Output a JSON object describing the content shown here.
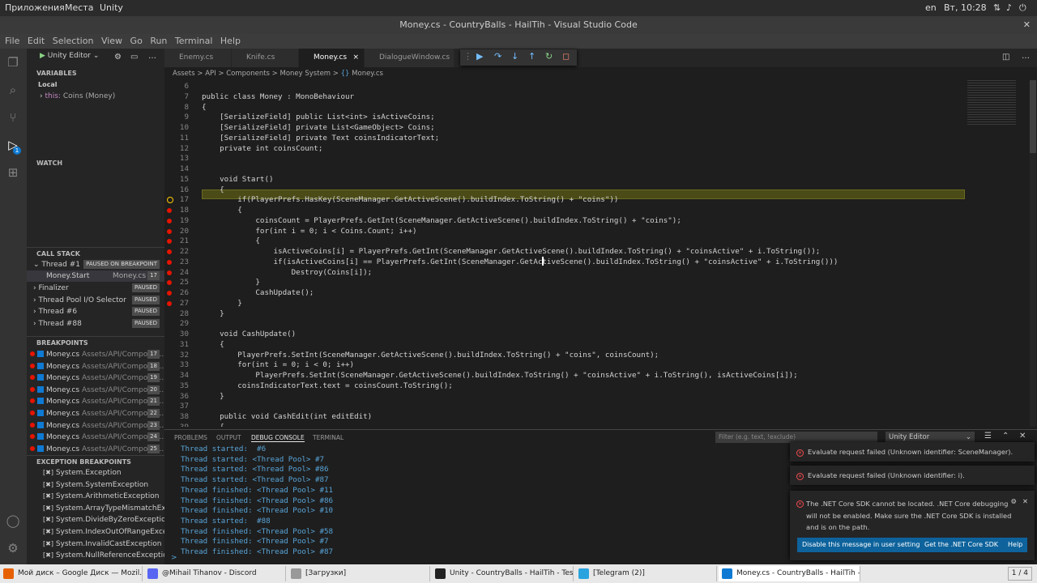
{
  "gnome": {
    "apps": "Приложения",
    "places": "Места",
    "app": "Unity",
    "lang": "en",
    "clock": "Вт, 10:28"
  },
  "window_title": "Money.cs - CountryBalls - HailTih - Visual Studio Code",
  "menu": [
    "File",
    "Edit",
    "Selection",
    "View",
    "Go",
    "Run",
    "Terminal",
    "Help"
  ],
  "run_config": "Unity Editor",
  "activity_badge": "1",
  "variables": {
    "header": "VARIABLES",
    "local": "Local",
    "this_label": "this:",
    "this_value": "Coins (Money)"
  },
  "watch_header": "WATCH",
  "callstack": {
    "header": "CALL STACK",
    "thread1": "Thread #1",
    "thread1_status": "PAUSED ON BREAKPOINT",
    "frame": "Money.Start",
    "frame_file": "Money.cs",
    "frame_line": "17",
    "others": [
      {
        "name": "Finalizer",
        "status": "PAUSED"
      },
      {
        "name": "Thread Pool I/O Selector",
        "status": "PAUSED"
      },
      {
        "name": "Thread #6",
        "status": "PAUSED"
      },
      {
        "name": "Thread #88",
        "status": "PAUSED"
      }
    ]
  },
  "breakpoints": {
    "header": "BREAKPOINTS",
    "items": [
      {
        "file": "Money.cs",
        "path": "Assets/API/Compone...",
        "line": "17"
      },
      {
        "file": "Money.cs",
        "path": "Assets/API/Compone...",
        "line": "18"
      },
      {
        "file": "Money.cs",
        "path": "Assets/API/Compone...",
        "line": "19"
      },
      {
        "file": "Money.cs",
        "path": "Assets/API/Compone...",
        "line": "20"
      },
      {
        "file": "Money.cs",
        "path": "Assets/API/Compone...",
        "line": "21"
      },
      {
        "file": "Money.cs",
        "path": "Assets/API/Compone...",
        "line": "22"
      },
      {
        "file": "Money.cs",
        "path": "Assets/API/Compone...",
        "line": "23"
      },
      {
        "file": "Money.cs",
        "path": "Assets/API/Compone...",
        "line": "24"
      },
      {
        "file": "Money.cs",
        "path": "Assets/API/Compone...",
        "line": "25"
      }
    ]
  },
  "exceptions": {
    "header": "EXCEPTION BREAKPOINTS",
    "items": [
      "System.Exception",
      "System.SystemException",
      "System.ArithmeticException",
      "System.ArrayTypeMismatchEx...",
      "System.DivideByZeroException",
      "System.IndexOutOfRangeExce...",
      "System.InvalidCastException",
      "System.NullReferenceException"
    ]
  },
  "tabs": [
    "Enemy.cs",
    "Knife.cs",
    "Money.cs",
    "DialogueWindow.cs"
  ],
  "breadcrumb": [
    "Assets",
    ">",
    "API",
    ">",
    "Components",
    ">",
    "Money System",
    ">",
    "Money.cs"
  ],
  "code_lines": [
    {
      "n": "6",
      "t": ""
    },
    {
      "n": "7",
      "t": "public class Money : MonoBehaviour"
    },
    {
      "n": "8",
      "t": "{"
    },
    {
      "n": "9",
      "t": "    [SerializeField] public List<int> isActiveCoins;"
    },
    {
      "n": "10",
      "t": "    [SerializeField] private List<GameObject> Coins;"
    },
    {
      "n": "11",
      "t": "    [SerializeField] private Text coinsIndicatorText;"
    },
    {
      "n": "12",
      "t": "    private int coinsCount;"
    },
    {
      "n": "13",
      "t": ""
    },
    {
      "n": "14",
      "t": ""
    },
    {
      "n": "15",
      "t": "    void Start()"
    },
    {
      "n": "16",
      "t": "    {"
    },
    {
      "n": "17",
      "t": "        if(PlayerPrefs.HasKey(SceneManager.GetActiveScene().buildIndex.ToString() + \"coins\"))"
    },
    {
      "n": "18",
      "t": "        {"
    },
    {
      "n": "19",
      "t": "            coinsCount = PlayerPrefs.GetInt(SceneManager.GetActiveScene().buildIndex.ToString() + \"coins\");"
    },
    {
      "n": "20",
      "t": "            for(int i = 0; i < Coins.Count; i++)"
    },
    {
      "n": "21",
      "t": "            {"
    },
    {
      "n": "22",
      "t": "                isActiveCoins[i] = PlayerPrefs.GetInt(SceneManager.GetActiveScene().buildIndex.ToString() + \"coinsActive\" + i.ToString());"
    },
    {
      "n": "23",
      "t": "                if(isActiveCoins[i] == PlayerPrefs.GetInt(SceneManager.GetActiveScene().buildIndex.ToString() + \"coinsActive\" + i.ToString()))"
    },
    {
      "n": "24",
      "t": "                    Destroy(Coins[i]);"
    },
    {
      "n": "25",
      "t": "            }"
    },
    {
      "n": "26",
      "t": "            CashUpdate();"
    },
    {
      "n": "27",
      "t": "        }"
    },
    {
      "n": "28",
      "t": "    }"
    },
    {
      "n": "29",
      "t": ""
    },
    {
      "n": "30",
      "t": "    void CashUpdate()"
    },
    {
      "n": "31",
      "t": "    {"
    },
    {
      "n": "32",
      "t": "        PlayerPrefs.SetInt(SceneManager.GetActiveScene().buildIndex.ToString() + \"coins\", coinsCount);"
    },
    {
      "n": "33",
      "t": "        for(int i = 0; i < 0; i++)"
    },
    {
      "n": "34",
      "t": "            PlayerPrefs.SetInt(SceneManager.GetActiveScene().buildIndex.ToString() + \"coinsActive\" + i.ToString(), isActiveCoins[i]);"
    },
    {
      "n": "35",
      "t": "        coinsIndicatorText.text = coinsCount.ToString();"
    },
    {
      "n": "36",
      "t": "    }"
    },
    {
      "n": "37",
      "t": ""
    },
    {
      "n": "38",
      "t": "    public void CashEdit(int editEdit)"
    },
    {
      "n": "39",
      "t": "    {"
    }
  ],
  "panel": {
    "tabs": [
      "PROBLEMS",
      "OUTPUT",
      "DEBUG CONSOLE",
      "TERMINAL"
    ],
    "filter_placeholder": "Filter (e.g. text, !exclude)",
    "dropdown": "Unity Editor",
    "lines": [
      "Thread started:  #6",
      "Thread started: <Thread Pool> #7",
      "Thread started: <Thread Pool> #86",
      "Thread started: <Thread Pool> #87",
      "Thread finished: <Thread Pool> #11",
      "Thread finished: <Thread Pool> #86",
      "Thread finished: <Thread Pool> #10",
      "Thread started:  #88",
      "Thread finished: <Thread Pool> #58",
      "Thread finished: <Thread Pool> #7",
      "Thread finished: <Thread Pool> #87"
    ],
    "prompt": ">"
  },
  "notifications": {
    "n1": "Evaluate request failed (Unknown identifier: SceneManager).",
    "n2": "Evaluate request failed (Unknown identifier: i).",
    "n3_l1": "The .NET Core SDK cannot be located. .NET Core debugging",
    "n3_l2": "will not be enabled. Make sure the .NET Core SDK is installed",
    "n3_l3": "and is on the path.",
    "btn_disable": "Disable this message in user settings",
    "btn_get": "Get the .NET Core SDK",
    "btn_help": "Help"
  },
  "taskbar": {
    "items": [
      {
        "label": "Мой диск – Google Диск — Mozil...",
        "color": "#e66000"
      },
      {
        "label": "@Mihail Tihanov - Discord",
        "color": "#5865f2"
      },
      {
        "label": "[Загрузки]",
        "color": "#999999"
      },
      {
        "label": "Unity - CountryBalls - HailTih - Tes...",
        "color": "#222222"
      },
      {
        "label": "[Telegram (2)]",
        "color": "#2aa3df"
      },
      {
        "label": "Money.cs - CountryBalls - HailTih -...",
        "color": "#0e7ad3"
      }
    ],
    "workspace": "1 / 4"
  }
}
